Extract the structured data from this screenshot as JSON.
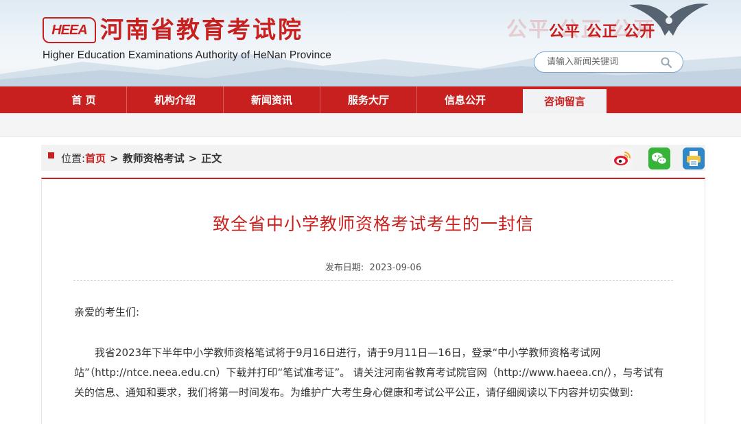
{
  "header": {
    "logo_mark": "HEEA",
    "logo_cn": "河南省教育考试院",
    "logo_en": "Higher Education Examinations Authority of HeNan Province",
    "slogan": "公平 公正 公开",
    "search_placeholder": "请输入新闻关键词",
    "colors": {
      "brand_red": "#c8201e",
      "search_border": "#7aa6cf"
    }
  },
  "nav": {
    "items": [
      {
        "label": "首 页"
      },
      {
        "label": "机构介绍"
      },
      {
        "label": "新闻资讯"
      },
      {
        "label": "服务大厅"
      },
      {
        "label": "信息公开"
      },
      {
        "label": "咨询留言"
      }
    ],
    "active": "咨询留言"
  },
  "breadcrumb": {
    "prefix": "位置:",
    "home": "首页",
    "separator": ">",
    "category": "教师资格考试",
    "current": "正文",
    "share_icons": [
      "weibo-icon",
      "wechat-icon",
      "print-icon"
    ]
  },
  "article": {
    "title": "致全省中小学教师资格考试考生的一封信",
    "date_label": "发布日期:",
    "date": "2023-09-06",
    "greeting": "亲爱的考生们:",
    "paragraph": "我省2023年下半年中小学教师资格笔试将于9月16日进行，请于9月11日—16日，登录“中小学教师资格考试网站”（http://ntce.neea.edu.cn）下载并打印“笔试准考证”。 请关注河南省教育考试院官网（http://www.haeea.cn/），与考试有关的信息、通知和要求，我们将第一时间发布。为维护广大考生身心健康和考试公平公正，请仔细阅读以下内容并切实做到:"
  }
}
